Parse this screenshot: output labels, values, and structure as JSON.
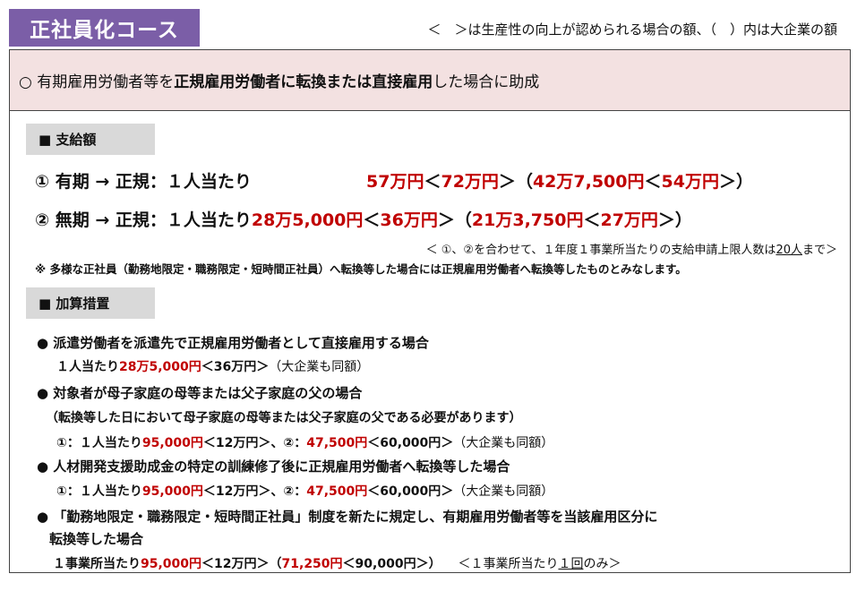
{
  "header": {
    "title": "正社員化コース",
    "note": "＜　＞は生産性の向上が認められる場合の額、（　）内は大企業の額"
  },
  "intro": {
    "prefix": "○ 有期雇用労働者等を",
    "bold": "正規雇用労働者に転換または直接雇用",
    "suffix": "した場合に助成"
  },
  "payment": {
    "heading": "■ 支給額",
    "rows": [
      {
        "label": "① 有期 → 正規：１人当たり",
        "a": "57万円",
        "b_open": "＜",
        "b": "72万円",
        "b_close": "＞",
        "c_open": "（",
        "c": "42万7,500円",
        "d_open": "＜",
        "d": "54万円",
        "d_close": "＞）"
      },
      {
        "label": "② 無期 → 正規：１人当たり",
        "a": "28万5,000円",
        "b_open": "＜",
        "b": "36万円",
        "b_close": "＞",
        "c_open": "（",
        "c": "21万3,750円",
        "d_open": "＜",
        "d": "27万円",
        "d_close": "＞）"
      }
    ],
    "limit_note_pre": "＜ ①、②を合わせて、１年度１事業所当たりの支給申請上限人数は",
    "limit_note_u": "20人",
    "limit_note_post": "まで＞",
    "footnote": "※ 多様な正社員（勤務地限定・職務限定・短時間正社員）へ転換等した場合には正規雇用労働者へ転換等したものとみなします。"
  },
  "addition": {
    "heading": "■ 加算措置",
    "items": [
      {
        "title": "● 派遣労働者を派遣先で正規雇用労働者として直接雇用する場合",
        "line_pre": "１人当たり",
        "line_a": "28万5,000円",
        "line_b": "＜36万円＞",
        "line_note": "（大企業も同額）"
      },
      {
        "title": "● 対象者が母子家庭の母等または父子家庭の父の場合",
        "sub_note": "（転換等した日において母子家庭の母等または父子家庭の父である必要があります）",
        "line_pre": "①：１人当たり",
        "line_a": "95,000円",
        "line_b": "＜12万円＞",
        "line_mid": "、②：",
        "line_c": "47,500円",
        "line_d": "＜60,000円＞",
        "line_note": "（大企業も同額）"
      },
      {
        "title": "● 人材開発支援助成金の特定の訓練修了後に正規雇用労働者へ転換等した場合",
        "line_pre": "①：１人当たり",
        "line_a": "95,000円",
        "line_b": "＜12万円＞",
        "line_mid": "、②：",
        "line_c": "47,500円",
        "line_d": "＜60,000円＞",
        "line_note": "（大企業も同額）"
      },
      {
        "title": "● 「勤務地限定・職務限定・短時間正社員」制度を新たに規定し、有期雇用労働者等を当該雇用区分に",
        "title2": "転換等した場合",
        "line_pre": "１事業所当たり",
        "line_a": "95,000円",
        "line_b": "＜12万円＞",
        "line_mid": "（",
        "line_c": "71,250円",
        "line_d": "＜90,000円＞",
        "line_end": "）",
        "line_note_pre": "＜１事業所当たり",
        "line_note_u": "１回",
        "line_note_post": "のみ＞"
      }
    ]
  }
}
